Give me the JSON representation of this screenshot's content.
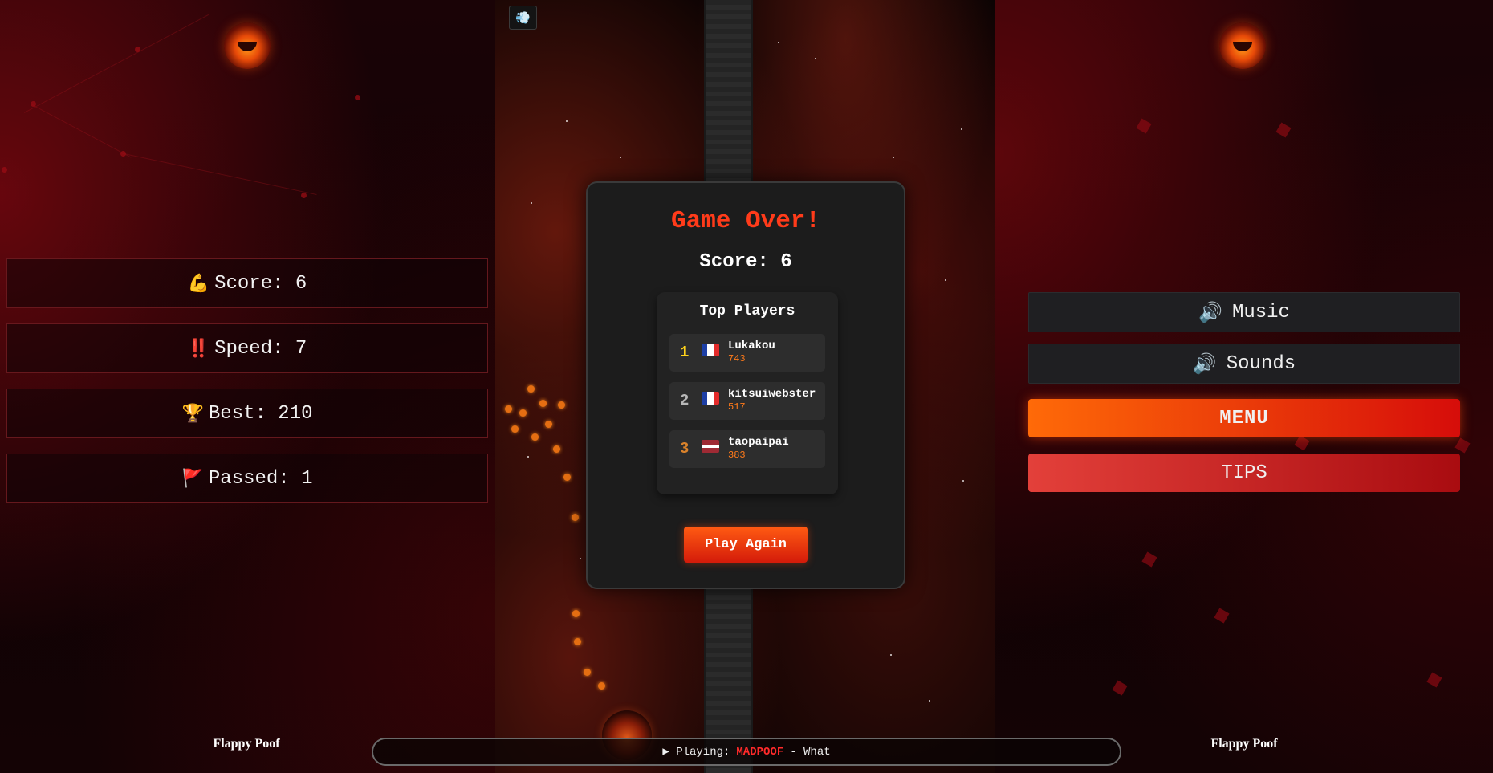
{
  "left_panel": {
    "stats": [
      {
        "icon": "💪",
        "icon_name": "flexed-biceps-icon",
        "label": "Score: 6"
      },
      {
        "icon": "‼️",
        "icon_name": "double-exclamation-icon",
        "label": "Speed: 7"
      },
      {
        "icon": "🏆",
        "icon_name": "trophy-icon",
        "label": "Best: 210"
      },
      {
        "icon": "🚩",
        "icon_name": "red-flag-icon",
        "label": "Passed: 1"
      }
    ],
    "brand": "Flappy Poof"
  },
  "right_panel": {
    "music_icon": "🔊",
    "music_label": "Music",
    "sounds_icon": "🔊",
    "sounds_label": "Sounds",
    "menu_label": "MENU",
    "tips_label": "TIPS",
    "brand": "Flappy Poof"
  },
  "game": {
    "pause_icon": "💨"
  },
  "game_over": {
    "title": "Game Over!",
    "score": "Score: 6",
    "leaderboard_title": "Top Players",
    "players": [
      {
        "rank": "1",
        "name": "Lukakou",
        "points": "743",
        "rank_color": "#ffd21a",
        "flag": "france"
      },
      {
        "rank": "2",
        "name": "kitsuiwebster",
        "points": "517",
        "rank_color": "#b8b8b8",
        "flag": "france"
      },
      {
        "rank": "3",
        "name": "taopaipai",
        "points": "383",
        "rank_color": "#d9822b",
        "flag": "latvia"
      }
    ],
    "play_again_label": "Play Again"
  },
  "now_playing": {
    "prefix": "▶ Playing:",
    "artist": "MADPOOF",
    "separator": "- What"
  },
  "colors": {
    "accent_orange": "#ff5b12",
    "accent_red": "#d41b0a",
    "title_red": "#ff3b1a",
    "points_orange": "#ff7a1a"
  }
}
